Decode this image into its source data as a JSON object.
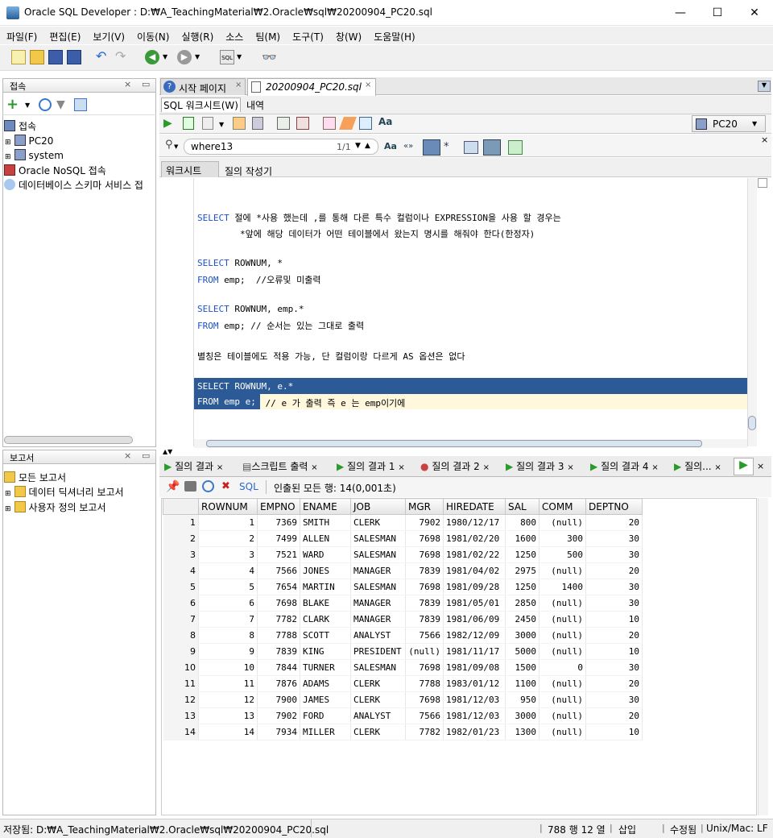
{
  "window": {
    "title": "Oracle SQL Developer : D:₩A_TeachingMaterial₩2.Oracle₩sql₩20200904_PC20.sql"
  },
  "menu": [
    "파일(F)",
    "편집(E)",
    "보기(V)",
    "이동(N)",
    "실행(R)",
    "소스",
    "팀(M)",
    "도구(T)",
    "창(W)",
    "도움말(H)"
  ],
  "connections_panel": {
    "title": "접속",
    "root": "접속",
    "items": [
      "PC20",
      "system",
      "Oracle NoSQL 접속",
      "데이터베이스 스키마 서비스 접"
    ]
  },
  "reports_panel": {
    "title": "보고서",
    "items": [
      "모든 보고서",
      "데이터 딕셔너리 보고서",
      "사용자 정의 보고서"
    ]
  },
  "editor_tabs": [
    "시작 페이지",
    "20200904_PC20.sql"
  ],
  "sheet_tabs": [
    "SQL 워크시트(W)",
    "내역"
  ],
  "connection_select": "PC20",
  "find": {
    "value": "where13",
    "count": "1/1"
  },
  "sub_tabs": [
    "워크시트",
    "질의 작성기"
  ],
  "code_lines": [
    {
      "kw": "SELECT",
      "rest": " 절에 *사용 했는데 ,를 통해 다른 특수 컬럼이나 EXPRESSION을 사용 할 경우는"
    },
    {
      "kw": "",
      "rest": "        *앞에 해당 데이터가 어떤 테이블에서 왔는지 명시를 해줘야 한다(한정자)"
    },
    {
      "kw": "SELECT",
      "rest": " ROWNUM, *"
    },
    {
      "kw": "FROM",
      "rest": " emp;  //오류및 미출력"
    },
    {
      "kw": "SELECT",
      "rest": " ROWNUM, emp.*"
    },
    {
      "kw": "FROM",
      "rest": " emp; // 순서는 있는 그대로 출력"
    },
    {
      "kw": "",
      "rest": "별칭은 테이블에도 적용 가능, 단 컬럼이랑 다르게 AS 옵션은 없다"
    },
    {
      "kw": "SELECT",
      "rest": " ROWNUM, e.*"
    },
    {
      "kw": "FROM",
      "rest": " emp e;"
    },
    {
      "kw": "",
      "rest": " // e 가 출력 즉 e 는 emp이기에"
    }
  ],
  "result_tabs": [
    "질의 결과",
    "스크립트 출력",
    "질의 결과 1",
    "질의 결과 2",
    "질의 결과 3",
    "질의 결과 4",
    "질의..."
  ],
  "result_info": {
    "sql_label": "SQL",
    "fetched": "인출된 모든 행: 14(0,001초)"
  },
  "table": {
    "columns": [
      "ROWNUM",
      "EMPNO",
      "ENAME",
      "JOB",
      "MGR",
      "HIREDATE",
      "SAL",
      "COMM",
      "DEPTNO"
    ],
    "rows": [
      [
        "1",
        "1",
        "7369",
        "SMITH",
        "CLERK",
        "7902",
        "1980/12/17",
        "800",
        "(null)",
        "20"
      ],
      [
        "2",
        "2",
        "7499",
        "ALLEN",
        "SALESMAN",
        "7698",
        "1981/02/20",
        "1600",
        "300",
        "30"
      ],
      [
        "3",
        "3",
        "7521",
        "WARD",
        "SALESMAN",
        "7698",
        "1981/02/22",
        "1250",
        "500",
        "30"
      ],
      [
        "4",
        "4",
        "7566",
        "JONES",
        "MANAGER",
        "7839",
        "1981/04/02",
        "2975",
        "(null)",
        "20"
      ],
      [
        "5",
        "5",
        "7654",
        "MARTIN",
        "SALESMAN",
        "7698",
        "1981/09/28",
        "1250",
        "1400",
        "30"
      ],
      [
        "6",
        "6",
        "7698",
        "BLAKE",
        "MANAGER",
        "7839",
        "1981/05/01",
        "2850",
        "(null)",
        "30"
      ],
      [
        "7",
        "7",
        "7782",
        "CLARK",
        "MANAGER",
        "7839",
        "1981/06/09",
        "2450",
        "(null)",
        "10"
      ],
      [
        "8",
        "8",
        "7788",
        "SCOTT",
        "ANALYST",
        "7566",
        "1982/12/09",
        "3000",
        "(null)",
        "20"
      ],
      [
        "9",
        "9",
        "7839",
        "KING",
        "PRESIDENT",
        "(null)",
        "1981/11/17",
        "5000",
        "(null)",
        "10"
      ],
      [
        "10",
        "10",
        "7844",
        "TURNER",
        "SALESMAN",
        "7698",
        "1981/09/08",
        "1500",
        "0",
        "30"
      ],
      [
        "11",
        "11",
        "7876",
        "ADAMS",
        "CLERK",
        "7788",
        "1983/01/12",
        "1100",
        "(null)",
        "20"
      ],
      [
        "12",
        "12",
        "7900",
        "JAMES",
        "CLERK",
        "7698",
        "1981/12/03",
        "950",
        "(null)",
        "30"
      ],
      [
        "13",
        "13",
        "7902",
        "FORD",
        "ANALYST",
        "7566",
        "1981/12/03",
        "3000",
        "(null)",
        "20"
      ],
      [
        "14",
        "14",
        "7934",
        "MILLER",
        "CLERK",
        "7782",
        "1982/01/23",
        "1300",
        "(null)",
        "10"
      ]
    ]
  },
  "status": {
    "saved": "저장됨: D:₩A_TeachingMaterial₩2.Oracle₩sql₩20200904_PC20.sql",
    "position": "788 행 12 열",
    "insert_mode": "삽입",
    "modified": "수정됨",
    "line_ending": "Unix/Mac: LF"
  }
}
